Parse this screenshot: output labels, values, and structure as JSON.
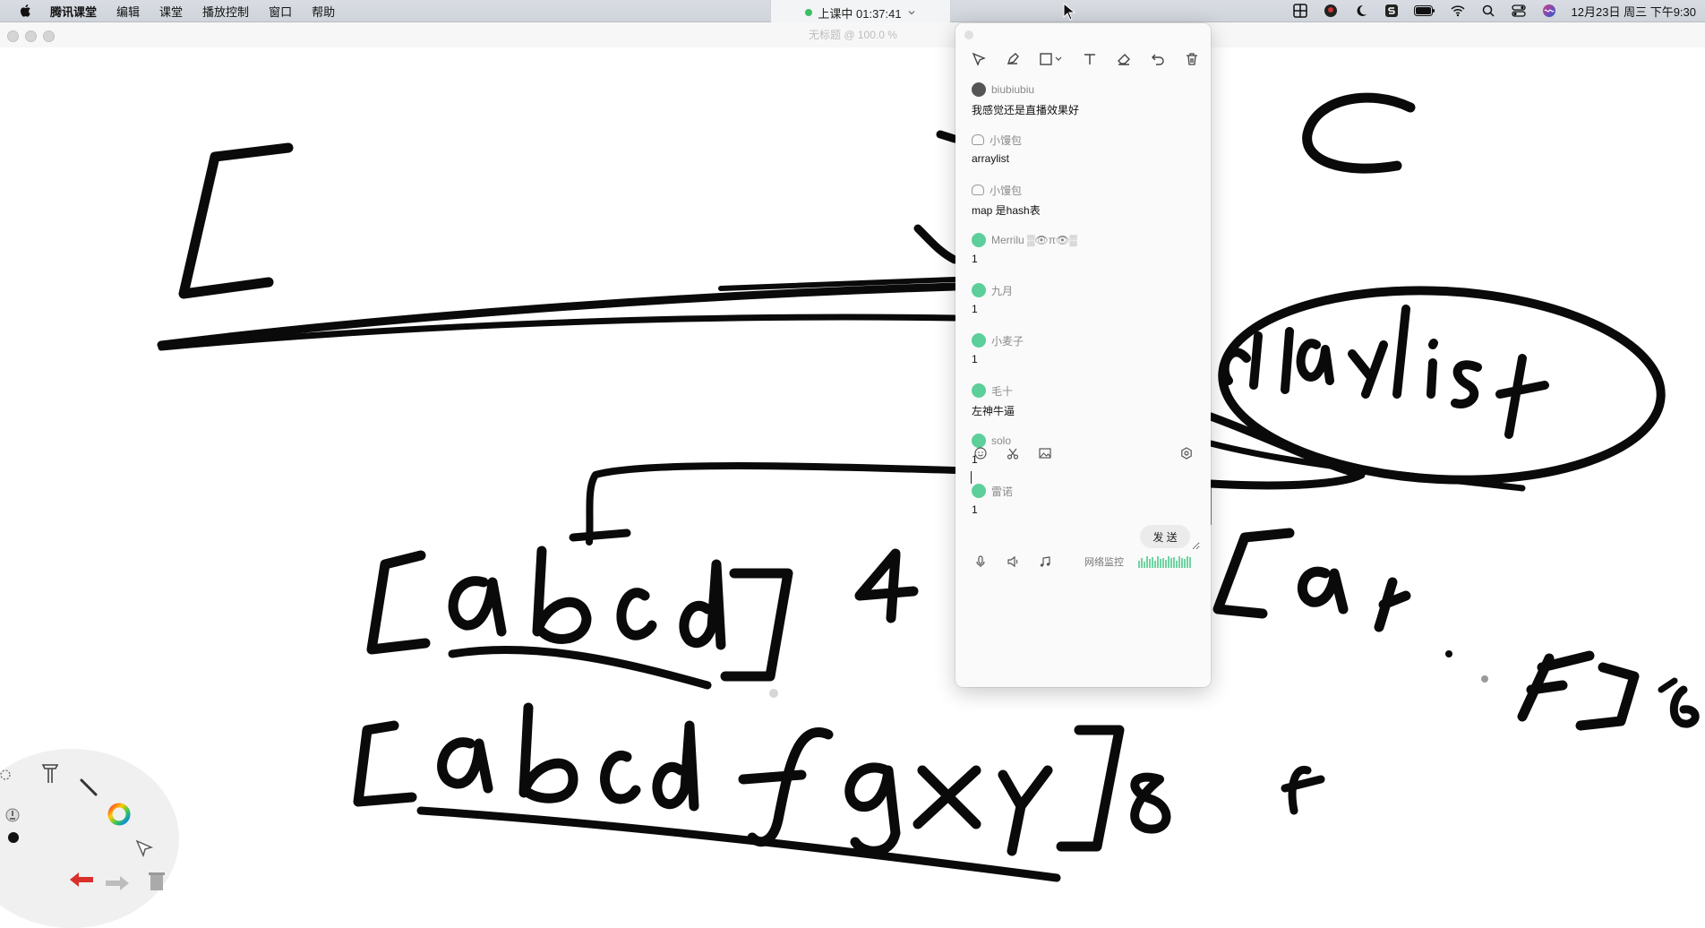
{
  "menubar": {
    "apple_icon": "apple-logo",
    "items": [
      "腾讯课堂",
      "编辑",
      "课堂",
      "播放控制",
      "窗口",
      "帮助"
    ],
    "session_status": "上课中 01:37:41",
    "clock": "12月23日 周三 下午9:30",
    "status_icons": [
      "grid-icon",
      "avatar-icon",
      "moon-icon",
      "s-icon",
      "battery-icon",
      "wifi-icon",
      "search-icon",
      "control-center-icon",
      "siri-icon"
    ]
  },
  "window": {
    "title": "无标题 @ 100.0 %"
  },
  "toolbar": {
    "tools": [
      "select-icon",
      "pen-icon",
      "shape-icon",
      "text-icon",
      "eraser-icon",
      "undo-icon",
      "trash-icon"
    ]
  },
  "chat": {
    "messages": [
      {
        "name": "biubiubiu",
        "text": "我感觉还是直播效果好",
        "avatar": "photo"
      },
      {
        "name": "小馒包",
        "text": "arraylist",
        "avatar": "outline"
      },
      {
        "name": "小馒包",
        "text": "map 是hash表",
        "avatar": "outline"
      },
      {
        "name": "Merrilu ▒👁π👁▒",
        "text": "1",
        "avatar": "green"
      },
      {
        "name": "九月",
        "text": "1",
        "avatar": "green"
      },
      {
        "name": "小麦子",
        "text": "1",
        "avatar": "green"
      },
      {
        "name": "毛十",
        "text": "左神牛逼",
        "avatar": "green"
      },
      {
        "name": "solo",
        "text": "1",
        "avatar": "green"
      },
      {
        "name": "雷诺",
        "text": "1",
        "avatar": "green"
      }
    ],
    "compose_tools": [
      "emoji-icon",
      "scissors-icon",
      "image-icon"
    ],
    "settings_icon": "settings-icon",
    "input_value": "",
    "send_label": "发 送",
    "bottom_icons": [
      "microphone-icon",
      "speaker-icon",
      "music-icon"
    ],
    "network_label": "网络监控",
    "network_levels": [
      0.6,
      0.8,
      0.5,
      0.9,
      0.7,
      0.85,
      0.6,
      0.95,
      0.7,
      0.8,
      0.65,
      0.9,
      0.75,
      0.85,
      0.6,
      0.9,
      0.8,
      0.7,
      0.9,
      0.85
    ]
  },
  "colors": {
    "accent_green": "#5ccf9a",
    "ink": "#111111",
    "status_green": "#3bbf63"
  },
  "tool_wheel": {
    "tools": [
      "lasso-icon",
      "hammer-icon",
      "brush-icon",
      "pen-size-icon",
      "color-wheel-icon",
      "pointer-icon",
      "undo-arrow-icon",
      "redo-arrow-icon",
      "delete-icon"
    ]
  }
}
